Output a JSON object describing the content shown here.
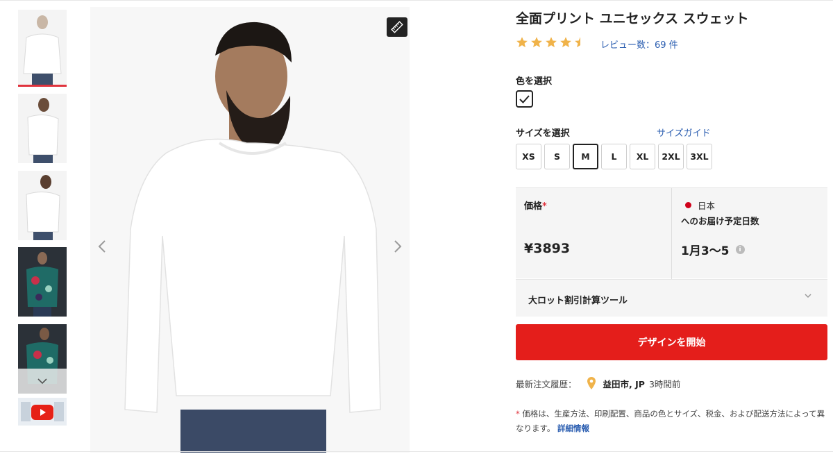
{
  "product": {
    "title": "全面プリント ユニセックス スウェット",
    "rating": 4.5,
    "review_label": "レビュー数：69 件"
  },
  "color": {
    "label": "色を選択",
    "selected": "white",
    "swatch_color": "#ffffff"
  },
  "size": {
    "label": "サイズを選択",
    "guide_label": "サイズガイド",
    "options": [
      "XS",
      "S",
      "M",
      "L",
      "XL",
      "2XL",
      "3XL"
    ],
    "selected": "M"
  },
  "price": {
    "label": "価格",
    "required_mark": "*",
    "value": "¥3893"
  },
  "shipping": {
    "country": "日本",
    "title": "へのお届け予定日数",
    "value": "1月3〜5",
    "info_icon": "info-icon"
  },
  "bulk": {
    "label": "大ロット割引計算ツール",
    "icon": "chevron-down-icon"
  },
  "cta": {
    "label": "デザインを開始",
    "color": "#e41e1b"
  },
  "recent_order": {
    "label": "最新注文履歴：",
    "city": "益田市, JP",
    "time": "3時間前",
    "icon": "map-pin-icon"
  },
  "note": {
    "mark": "*",
    "text": "価格は、生産方法、印刷配置、商品の色とサイズ、税金、および配送方法によって異なります。",
    "link": "詳細情報"
  },
  "thumbnails": [
    {
      "name": "white-front"
    },
    {
      "name": "white-side"
    },
    {
      "name": "white-back"
    },
    {
      "name": "pattern-front"
    },
    {
      "name": "pattern-back"
    },
    {
      "name": "video"
    }
  ],
  "colors": {
    "accent": "#e0333d",
    "link": "#2a5db0",
    "star": "#f0b34a"
  }
}
